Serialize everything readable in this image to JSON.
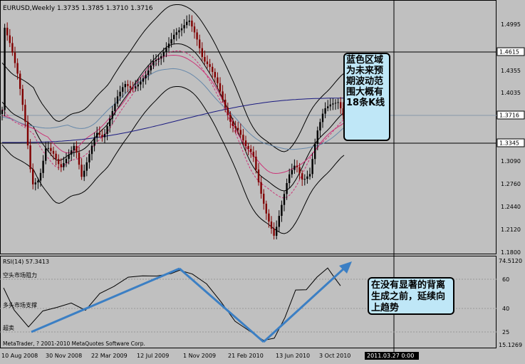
{
  "chart_header": {
    "symbol": "EURUSD,Weekly",
    "open": "1.3735",
    "high": "1.3785",
    "low": "1.3710",
    "close": "1.3716"
  },
  "price_axis": {
    "ticks": [
      "1.4995",
      "1.4355",
      "1.4035",
      "1.3716",
      "1.3090",
      "1.2760",
      "1.2440",
      "1.2120",
      "1.1800"
    ],
    "highlighted": [
      "1.4615",
      "1.3716",
      "1.3345"
    ]
  },
  "rsi_panel": {
    "label": "RSI(14) 57.3413",
    "ticks": [
      "74.5120",
      "60",
      "40",
      "25",
      "15.1269"
    ],
    "zone_labels": [
      "空头市场阻力",
      "多头市场支撑",
      "超卖"
    ]
  },
  "time_axis": {
    "labels": [
      "10 Aug 2008",
      "30 Nov 2008",
      "22 Mar 2009",
      "12 Jul 2009",
      "1 Nov 2009",
      "21 Feb 2010",
      "13 Jun 2010",
      "3 Oct 2010"
    ],
    "cursor_time": "2011.03.27 0:00"
  },
  "annotations": {
    "main": "蓝色区域为未来预期波动范围大概有18条K线",
    "rsi": "在没有显著的背离生成之前，延续向上趋势"
  },
  "copyright": "MetaTrader, ? 2001-2010 MetaQuotes Software Corp.",
  "colors": {
    "background": "#c0c0c0",
    "up_candle": "#000000",
    "down_candle": "#800000",
    "band": "#000000",
    "ma_pink": "#cc3377",
    "ma_blue": "#6688aa",
    "ma_navy": "#1a1a80",
    "trend_arrow": "#3b7fc4",
    "annotation_bg": "#bfe7f7"
  }
}
